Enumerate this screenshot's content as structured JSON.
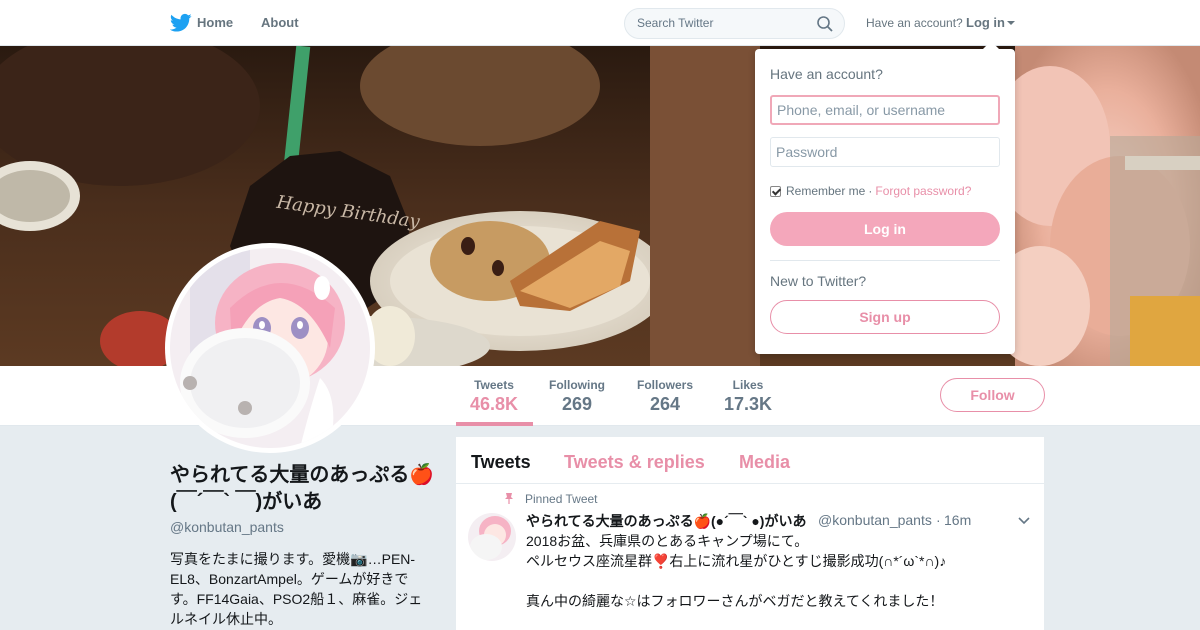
{
  "nav": {
    "home_label": "Home",
    "about_label": "About",
    "search_placeholder": "Search Twitter",
    "have_account": "Have an account?",
    "login_label": "Log in"
  },
  "login_dropdown": {
    "title": "Have an account?",
    "username_placeholder": "Phone, email, or username",
    "password_placeholder": "Password",
    "remember_label": "Remember me",
    "separator": "·",
    "forgot_label": "Forgot password?",
    "login_button": "Log in",
    "new_label": "New to Twitter?",
    "signup_button": "Sign up"
  },
  "stats": [
    {
      "label": "Tweets",
      "value": "46.8K"
    },
    {
      "label": "Following",
      "value": "269"
    },
    {
      "label": "Followers",
      "value": "264"
    },
    {
      "label": "Likes",
      "value": "17.3K"
    }
  ],
  "follow_label": "Follow",
  "profile": {
    "name": "やられてる大量のあっぷる🍎(￣´￣` ￣)がいあ",
    "handle": "@konbutan_pants",
    "bio": "写真をたまに撮ります。愛機📷…PEN-EL8、BonzartAmpel。ゲームが好きです。FF14Gaia、PSO2船１、麻雀。ジェルネイル休止中。"
  },
  "timeline": {
    "tabs": [
      "Tweets",
      "Tweets & replies",
      "Media"
    ],
    "pinned_label": "Pinned Tweet",
    "tweet": {
      "name": "やられてる大量のあっぷる🍎(●´￣` ●)がいあ",
      "handle": "@konbutan_pants",
      "dot": "·",
      "time": "16m",
      "lines": [
        "2018お盆、兵庫県のとあるキャンプ場にて。",
        "ペルセウス座流星群❣️右上に流れ星がひとすじ撮影成功(∩*´ω`*∩)♪",
        "",
        "真ん中の綺麗な☆はフォロワーさんがベガだと教えてくれました！"
      ]
    }
  },
  "banner": {
    "cake_plate_text": "Happy Birthday"
  },
  "colors": {
    "accent": "#e88fa8",
    "twitter_blue": "#1da1f2",
    "gray_text": "#657786"
  }
}
